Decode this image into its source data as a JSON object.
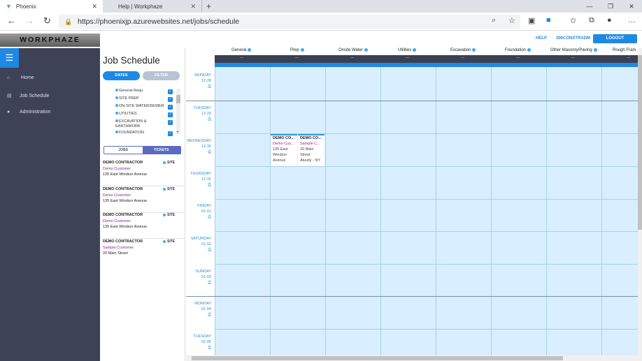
{
  "browser": {
    "tabs": [
      {
        "label": "Phoenix"
      },
      {
        "label": "Help | Workphaze"
      }
    ],
    "url": "https://phoenixjp.azurewebsites.net/jobs/schedule"
  },
  "header": {
    "logo": "WORKPHAZE",
    "help": "HELP",
    "user": "306CONSTRADM",
    "logout": "LOGOUT"
  },
  "sidebar": {
    "items": [
      {
        "label": "Home",
        "icon": "home-icon"
      },
      {
        "label": "Job Schedule",
        "icon": "calendar-icon"
      },
      {
        "label": "Administration",
        "icon": "person-icon"
      }
    ]
  },
  "panel": {
    "title": "Job Schedule",
    "dates_btn": "DATES",
    "filter_btn": "FILTER",
    "filters": [
      "General Requ",
      "SITE PREP",
      "ON-SITE WATER/SEWER",
      "UTILITIES",
      "EXCAVATION & EARTHWORK",
      "FOUNDATION"
    ],
    "jobs_tab": "JOBS",
    "tickets_tab": "TICKETS",
    "cards": [
      {
        "contractor": "DEMO CONTRACTOR",
        "customer": "Demo Customer",
        "address": "135 East Windsor Avenue",
        "badge": "SITE"
      },
      {
        "contractor": "DEMO CONTRACTOR",
        "customer": "Demo Customer",
        "address": "135 East Windsor Avenue",
        "badge": "SITE"
      },
      {
        "contractor": "DEMO CONTRACTOR",
        "customer": "Demo Customer",
        "address": "135 East Windsor Avenue",
        "badge": "SITE"
      },
      {
        "contractor": "DEMO CONTRACTOR",
        "customer": "Sample Customer",
        "address": "20 Main Street",
        "badge": "SITE"
      }
    ]
  },
  "schedule": {
    "columns": [
      "General",
      "Prep",
      "Onsite Water",
      "Utilities",
      "Excavation",
      "Foundation",
      "Other Masonry/Paving",
      "Rough Fram"
    ],
    "dash": "—",
    "days": [
      {
        "name": "MONDAY",
        "date": "12-28"
      },
      {
        "name": "TUESDAY",
        "date": "12-29"
      },
      {
        "name": "WEDNESDAY",
        "date": "12-30"
      },
      {
        "name": "THURSDAY",
        "date": "12-31"
      },
      {
        "name": "FRIDAY",
        "date": "01-01"
      },
      {
        "name": "SATURDAY",
        "date": "01-02"
      },
      {
        "name": "SUNDAY",
        "date": "01-03"
      },
      {
        "name": "MONDAY",
        "date": "01-04"
      },
      {
        "name": "TUESDAY",
        "date": "01-05"
      }
    ],
    "events": [
      {
        "title": "DEMO CO...",
        "customer": "Demo Cus...",
        "addr1": "135 East",
        "addr2": "Windsor",
        "addr3": "Avenue"
      },
      {
        "title": "DEMO CO...",
        "customer": "Sample C...",
        "addr1": "20 Main",
        "addr2": "Street",
        "addr3": "Atuvity - NY"
      }
    ]
  }
}
